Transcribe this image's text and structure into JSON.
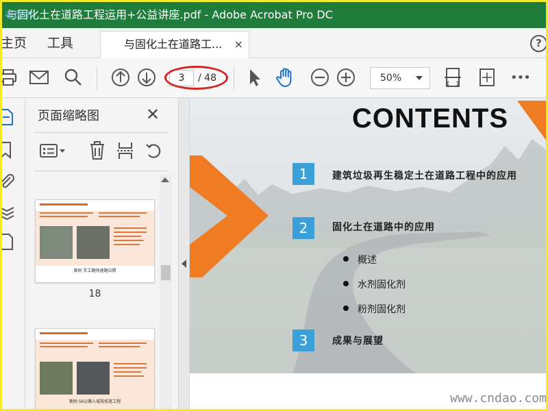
{
  "window": {
    "title": "与固化土在道路工程运用+公益讲座.pdf - Adobe Acrobat Pro DC",
    "logo_text": "毛优尔"
  },
  "tabbar": {
    "menu": [
      "主页",
      "工具"
    ],
    "doc_tab_label": "与固化土在道路工...",
    "close_glyph": "×",
    "help_glyph": "?"
  },
  "toolbar": {
    "current_page": "3",
    "total_pages": "/ 48",
    "zoom": "50%",
    "icons": [
      "print-icon",
      "email-icon",
      "search-icon",
      "page-up-icon",
      "page-down-icon",
      "select-arrow-icon",
      "hand-tool-icon",
      "zoom-out-icon",
      "zoom-in-icon",
      "fit-page-icon",
      "full-screen-icon",
      "more-icon"
    ],
    "more_glyph": "•••"
  },
  "thumbnail_panel": {
    "title": "页面缩略图",
    "close_glyph": "✕",
    "page_label": "18",
    "thumb1_caption": "案例 军工路快速路日照",
    "thumb2_caption": "案例 S6公路入城段拓宽工程"
  },
  "slide": {
    "heading": "CONTENTS",
    "items": [
      {
        "number": "1",
        "title": "建筑垃圾再生稳定土在道路工程中的应用"
      },
      {
        "number": "2",
        "title": "固化土在道路中的应用"
      },
      {
        "number": "3",
        "title": "成果与展望"
      }
    ],
    "bullets": [
      "概述",
      "水剂固化剂",
      "粉剂固化剂"
    ],
    "accent_color": "#ef7b22",
    "number_color": "#3aa0d8"
  },
  "watermark": {
    "text": "www.cndao.com"
  }
}
